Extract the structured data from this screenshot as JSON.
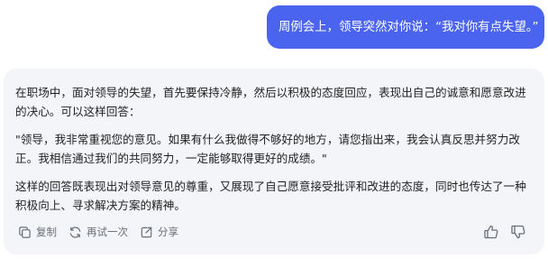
{
  "conversation": {
    "user_message": "周例会上，领导突然对你说：“我对你有点失望。”",
    "assistant_reply": {
      "paragraphs": [
        "在职场中，面对领导的失望，首先要保持冷静，然后以积极的态度回应，表现出自己的诚意和愿意改进的决心。可以这样回答：",
        "\"领导，我非常重视您的意见。如果有什么我做得不够好的地方，请您指出来，我会认真反思并努力改正。我相信通过我们的共同努力，一定能够取得更好的成绩。\"",
        "这样的回答既表现出对领导意见的尊重，又展现了自己愿意接受批评和改进的态度，同时也传达了一种积极向上、寻求解决方案的精神。"
      ]
    }
  },
  "actions": {
    "copy_label": "复制",
    "copy_icon": "copy-icon",
    "retry_label": "再试一次",
    "retry_icon": "refresh-icon",
    "share_label": "分享",
    "share_icon": "share-icon",
    "like_icon": "thumbs-up-icon",
    "dislike_icon": "thumbs-down-icon"
  },
  "colors": {
    "user_bubble": "#4a64f0",
    "reply_card": "#f4f5f8",
    "action_text": "#6a6e78"
  }
}
